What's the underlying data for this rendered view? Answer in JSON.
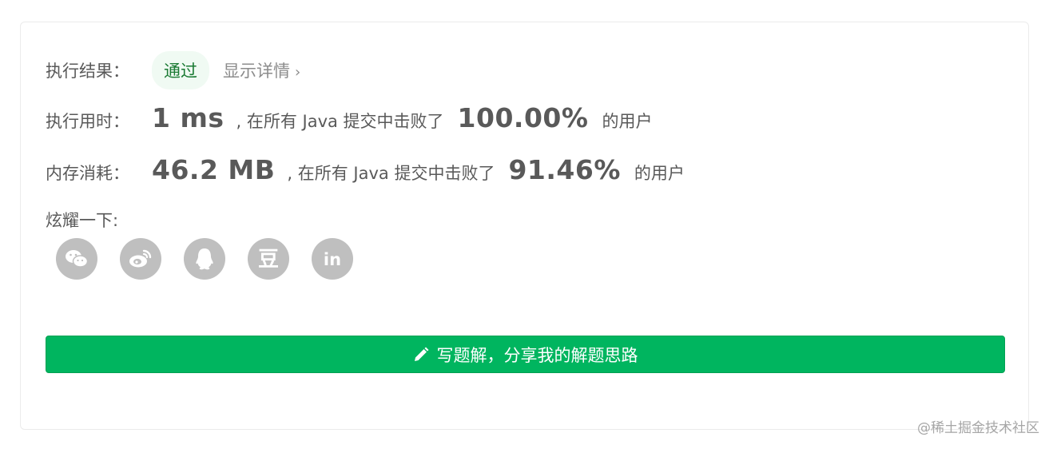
{
  "result": {
    "label": "执行结果：",
    "status": "通过",
    "details_link": "显示详情",
    "details_chevron": "›"
  },
  "runtime": {
    "label": "执行用时：",
    "value": "1 ms",
    "mid_text": ", 在所有 Java 提交中击败了",
    "percent": "100.00%",
    "suffix": "的用户"
  },
  "memory": {
    "label": "内存消耗：",
    "value": "46.2 MB",
    "mid_text": ", 在所有 Java 提交中击败了",
    "percent": "91.46%",
    "suffix": "的用户"
  },
  "share": {
    "label": "炫耀一下:",
    "icons": [
      "wechat-icon",
      "weibo-icon",
      "qq-icon",
      "douban-icon",
      "linkedin-icon"
    ],
    "douban_glyph": "豆",
    "linkedin_glyph": "in"
  },
  "write_solution": {
    "label": "写题解，分享我的解题思路",
    "icon": "pencil-icon"
  },
  "watermark": "@稀土掘金技术社区",
  "colors": {
    "accent_green": "#00b55f",
    "pass_badge_bg": "#f0faf3",
    "icon_gray": "#bfbfbf"
  }
}
